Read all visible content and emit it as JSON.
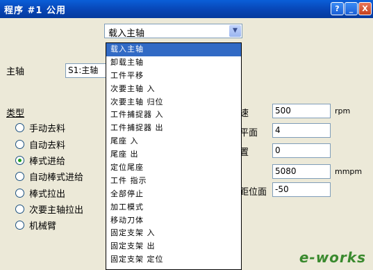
{
  "window": {
    "title": "程序 #1 公用",
    "buttons": {
      "help": "?",
      "minimize": "_",
      "close": "X"
    }
  },
  "spindle_combo": {
    "value": "载入主轴"
  },
  "dropdown": {
    "items": [
      "载入主轴",
      "卸载主轴",
      "工件平移",
      "次要主轴 入",
      "次要主轴 归位",
      "工件捕捉器 入",
      "工件捕捉器 出",
      "尾座 入",
      "尾座 出",
      "定位尾座",
      "工件 指示",
      "全部停止",
      "加工模式",
      "移动刀体",
      "固定支架 入",
      "固定支架 出",
      "固定支架 定位"
    ],
    "selected_index": 0
  },
  "spindle": {
    "label": "主轴",
    "value": "S1:主轴"
  },
  "type_section": {
    "label": "类型",
    "options": [
      "手动去料",
      "自动去料",
      "棒式进给",
      "自动棒式进给",
      "棒式拉出",
      "次要主轴拉出",
      "机械臂"
    ],
    "selected_index": 2
  },
  "params": [
    {
      "label_visible": "速",
      "value": "500",
      "unit": "rpm"
    },
    {
      "label_visible": "平面",
      "value": "4",
      "unit": ""
    },
    {
      "label_visible": "置",
      "value": "0",
      "unit": ""
    },
    {
      "label_visible": "",
      "value": "5080",
      "unit": "mmpm"
    },
    {
      "label_visible": "距位面",
      "value": "-50",
      "unit": ""
    }
  ],
  "watermark": "e-works"
}
